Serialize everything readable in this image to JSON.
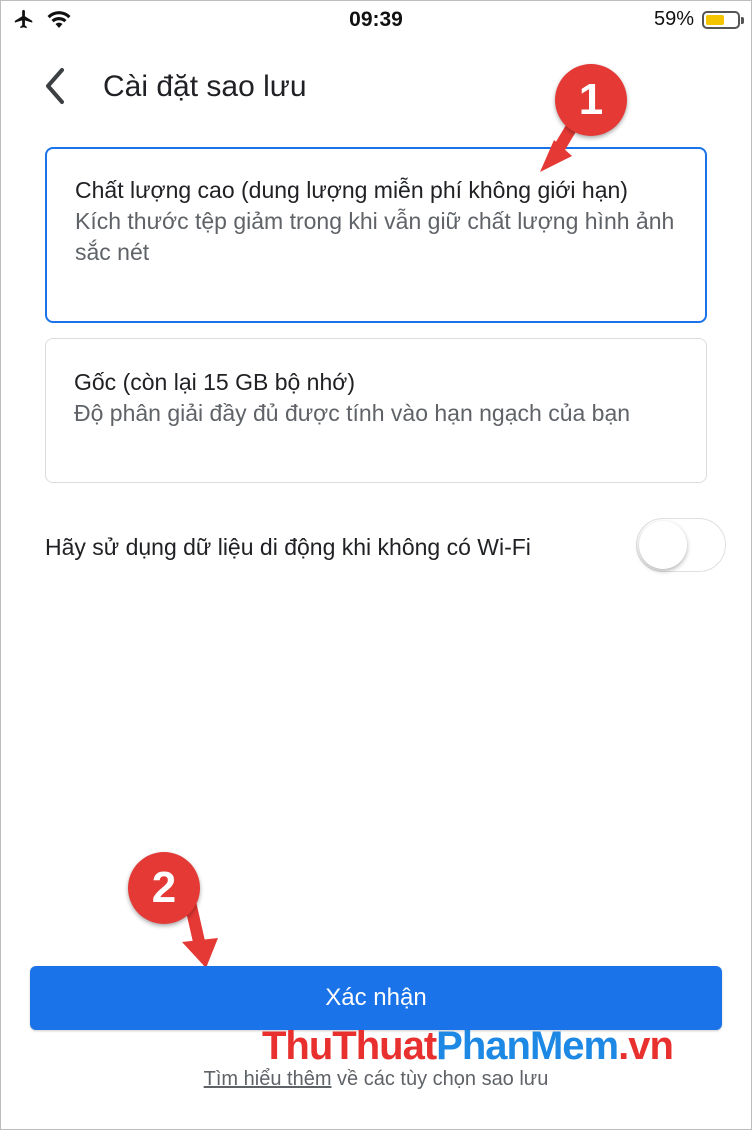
{
  "status_bar": {
    "time": "09:39",
    "battery_text": "59%",
    "battery_level": 0.59,
    "battery_color": "#f4c400",
    "left_icons": [
      "airplane-icon",
      "wifi-icon"
    ]
  },
  "header": {
    "title": "Cài đặt sao lưu",
    "back_icon": "chevron-left-icon"
  },
  "options": [
    {
      "title": "Chất lượng cao (dung lượng miễn phí không giới hạn)",
      "description": "Kích thước tệp giảm trong khi vẫn giữ chất lượng hình ảnh sắc nét",
      "selected": true
    },
    {
      "title": "Gốc (còn lại 15 GB bộ nhớ)",
      "description": "Độ phân giải đầy đủ được tính vào hạn ngạch của bạn",
      "selected": false
    }
  ],
  "mobile_data": {
    "label": "Hãy sử dụng dữ liệu di động khi không có Wi-Fi",
    "enabled": false
  },
  "confirm_button": {
    "label": "Xác nhận",
    "color": "#1a73e8"
  },
  "footer": {
    "link_text": "Tìm hiểu thêm",
    "rest_text": " về các tùy chọn sao lưu"
  },
  "annotations": {
    "marker1": "1",
    "marker2": "2",
    "color": "#e53935"
  },
  "watermark": {
    "part1": "ThuThuat",
    "part2": "PhanMem",
    "part3": ".vn"
  }
}
